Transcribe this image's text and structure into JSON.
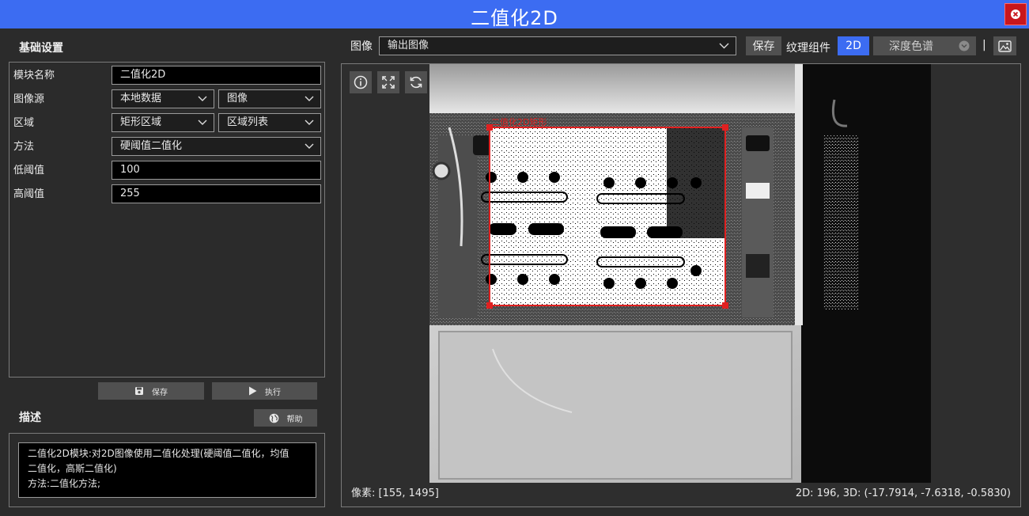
{
  "window": {
    "title": "二值化2D"
  },
  "left": {
    "settings_title": "基础设置",
    "fields": {
      "module_name_label": "模块名称",
      "module_name_value": "二值化2D",
      "image_source_label": "图像源",
      "image_source_value": "本地数据",
      "image_source_type": "图像",
      "region_label": "区域",
      "region_value": "矩形区域",
      "region_list": "区域列表",
      "method_label": "方法",
      "method_value": "硬阈值二值化",
      "low_label": "低阈值",
      "low_value": "100",
      "high_label": "高阈值",
      "high_value": "255"
    },
    "save_label": "保存",
    "run_label": "执行",
    "desc_title": "描述",
    "help_label": "帮助",
    "description": {
      "line1": "二值化2D模块:对2D图像使用二值化处理(硬阈值二值化，均值",
      "line2": "二值化，高斯二值化)",
      "line3": "方法:二值化方法;"
    }
  },
  "right": {
    "image_label": "图像",
    "image_select": "输出图像",
    "save_label": "保存",
    "texture_label": "纹理组件",
    "mode_2d": "2D",
    "depth_select": "深度色谱",
    "divider": "|",
    "roi_label": "二值化2D矩形",
    "pixel_status": "像素: [155, 1495]",
    "coord_status": "2D: 196, 3D: (-17.7914, -7.6318, -0.5830)"
  },
  "colors": {
    "title_bar": "#3c6cf2",
    "close_button": "#c8161d",
    "active_button": "#3c6cf2",
    "roi": "#e02020"
  },
  "icons": [
    "close-icon",
    "save-icon",
    "play-icon",
    "globe-icon",
    "chevron-down-icon",
    "info-icon",
    "fit-icon",
    "refresh-icon",
    "image-icon"
  ]
}
